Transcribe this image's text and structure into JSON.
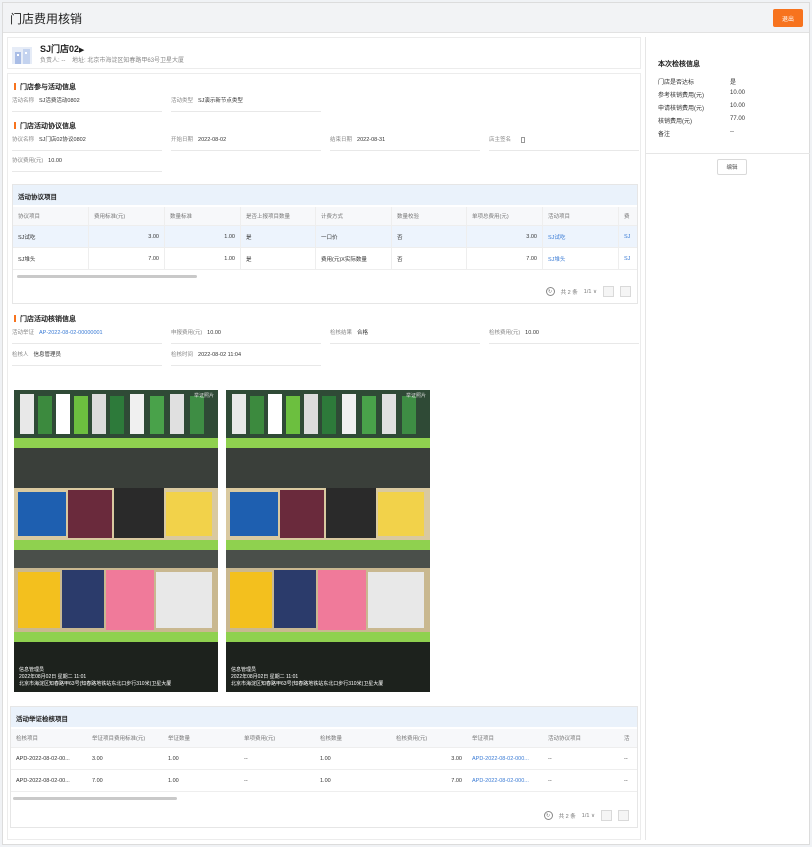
{
  "window": {
    "title": "门店费用核销",
    "exit_label": "退出"
  },
  "store": {
    "name": "SJ门店02",
    "manager_label": "负责人:",
    "manager": "--",
    "address_label": "地址:",
    "address": "北京市海淀区知春路甲63号卫星大厦"
  },
  "activity": {
    "section_title": "门店参与活动信息",
    "name_label": "活动名称",
    "name": "SJ活费活动0802",
    "type_label": "活动类型",
    "type": "SJ演示新节点类型"
  },
  "agreement": {
    "section_title": "门店活动协议信息",
    "name_label": "协议名称",
    "name": "SJ门店02协议0802",
    "start_label": "开始日期",
    "start": "2022-08-02",
    "end_label": "结束日期",
    "end": "2022-08-31",
    "sign_label": "店主签名",
    "sign": "",
    "fee_label": "协议费用(元)",
    "fee": "10.00"
  },
  "items_table": {
    "title": "活动协议项目",
    "columns": [
      "协议项目",
      "费用标准(元)",
      "数量标准",
      "是否上报项目数量",
      "计费方式",
      "数量校验",
      "单项总费用(元)",
      "活动项目",
      "费"
    ],
    "rows": [
      [
        "SJ试吃",
        "3.00",
        "1.00",
        "是",
        "一口价",
        "否",
        "3.00",
        "SJ试吃",
        "SJ"
      ],
      [
        "SJ堆头",
        "7.00",
        "1.00",
        "是",
        "费用(元)X实际数量",
        "否",
        "7.00",
        "SJ堆头",
        "SJ"
      ]
    ],
    "pager": {
      "total": "共 2 条",
      "page": "1/1",
      "refresh_icon": "refresh-icon"
    }
  },
  "writeoff": {
    "section_title": "门店活动核销信息",
    "voucher_label": "活动举证",
    "voucher": "AP-2022-08-02-00000001",
    "declared_label": "申报费用(元)",
    "declared": "10.00",
    "result_label": "检核结果",
    "result": "合格",
    "check_fee_label": "检核费用(元)",
    "check_fee": "10.00",
    "checker_label": "检核人",
    "checker": "信息管理员",
    "check_time_label": "检核时间",
    "check_time": "2022-08-02 11:04"
  },
  "photos": [
    {
      "tag": "举证照片",
      "user": "信息管理员",
      "time": "2022年08月02日  星期二  11:01",
      "location": "北京市海淀区知春路甲63号(知春路地铁站东北口步行310米)卫星大厦"
    },
    {
      "tag": "举证照片",
      "user": "信息管理员",
      "time": "2022年08月02日  星期二  11:01",
      "location": "北京市海淀区知春路甲63号(知春路地铁站东北口步行310米)卫星大厦"
    }
  ],
  "proof_table": {
    "title": "活动举证检核项目",
    "columns": [
      "检核项目",
      "举证项目费用标准(元)",
      "举证数量",
      "单项费用(元)",
      "检核数量",
      "检核费用(元)",
      "举证项目",
      "活动协议项目",
      "活"
    ],
    "rows": [
      [
        "APD-2022-08-02-00...",
        "3.00",
        "1.00",
        "--",
        "1.00",
        "3.00",
        "APD-2022-08-02-000...",
        "--",
        "--"
      ],
      [
        "APD-2022-08-02-00...",
        "7.00",
        "1.00",
        "--",
        "1.00",
        "7.00",
        "APD-2022-08-02-000...",
        "--",
        "--"
      ]
    ],
    "pager": {
      "total": "共 2 条",
      "page": "1/1"
    }
  },
  "side": {
    "title": "本次检核信息",
    "items": [
      {
        "label": "门店是否达标",
        "value": "是"
      },
      {
        "label": "参考核销费用(元)",
        "value": "10.00"
      },
      {
        "label": "申请核销费用(元)",
        "value": "10.00"
      },
      {
        "label": "核销费用(元)",
        "value": "77.00"
      },
      {
        "label": "备注",
        "value": "--"
      }
    ],
    "edit_label": "编辑"
  },
  "colors": {
    "accent": "#f7731e",
    "link": "#3a7bd5",
    "table_header": "#eaf2fb"
  }
}
